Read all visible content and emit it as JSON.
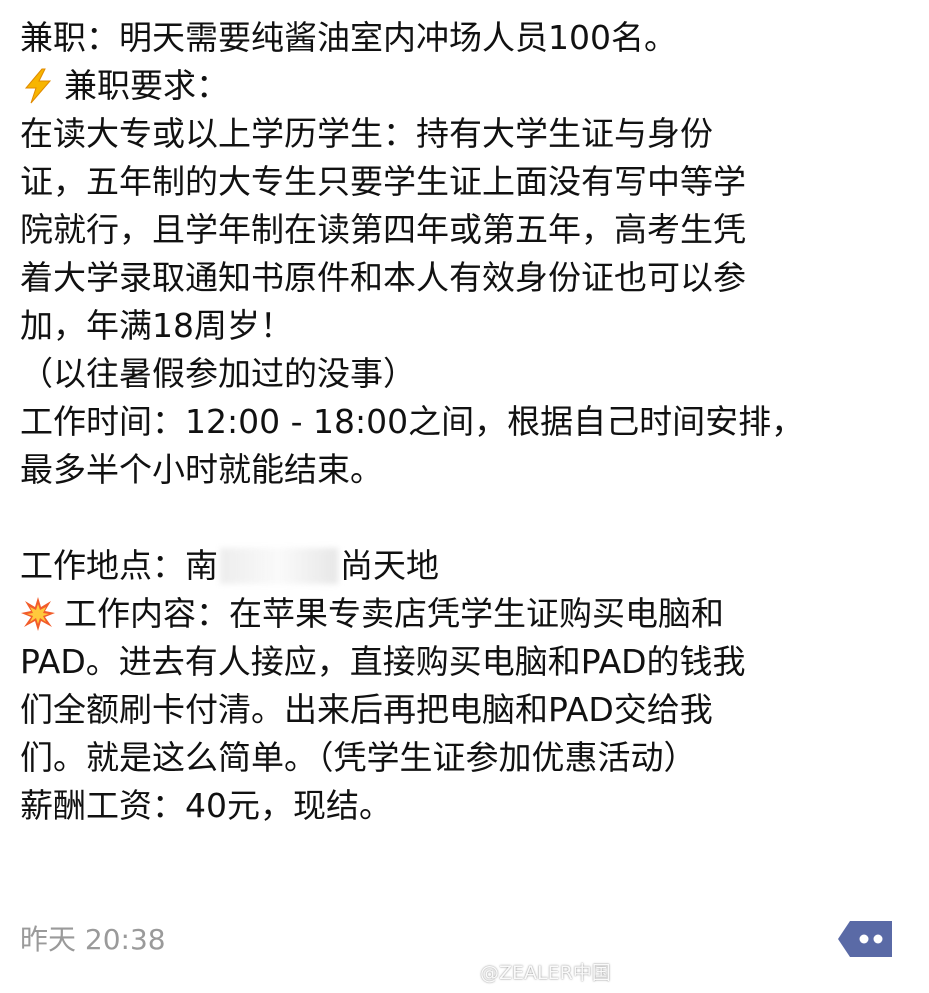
{
  "message": {
    "lines": [
      "兼职：明天需要纯酱油室内冲场人员100名。",
      "兼职要求：",
      "在读大专或以上学历学生：持有大学生证与身份",
      "证，五年制的大专生只要学生证上面没有写中等学",
      "院就行，且学年制在读第四年或第五年，高考生凭",
      "着大学录取通知书原件和本人有效身份证也可以参",
      "加，年满18周岁！",
      "（以往暑假参加过的没事）",
      "工作时间：12:00 - 18:00之间，根据自己时间安排，",
      "最多半个小时就能结束。",
      "",
      "工作地点：南",
      "尚天地",
      "工作内容：在苹果专卖店凭学生证购买电脑和",
      "PAD。进去有人接应，直接购买电脑和PAD的钱我",
      "们全额刷卡付清。出来后再把电脑和PAD交给我",
      "们。就是这么简单。（凭学生证参加优惠活动）",
      "薪酬工资：40元，现结。"
    ],
    "icons": {
      "requirements": "lightning-icon",
      "content": "collision-icon"
    }
  },
  "timestamp": "昨天 20:38",
  "watermark": "@ZEALER中国",
  "colors": {
    "text": "#111111",
    "timestamp": "#9a9a9a",
    "more_button": "#5a6aa6"
  }
}
